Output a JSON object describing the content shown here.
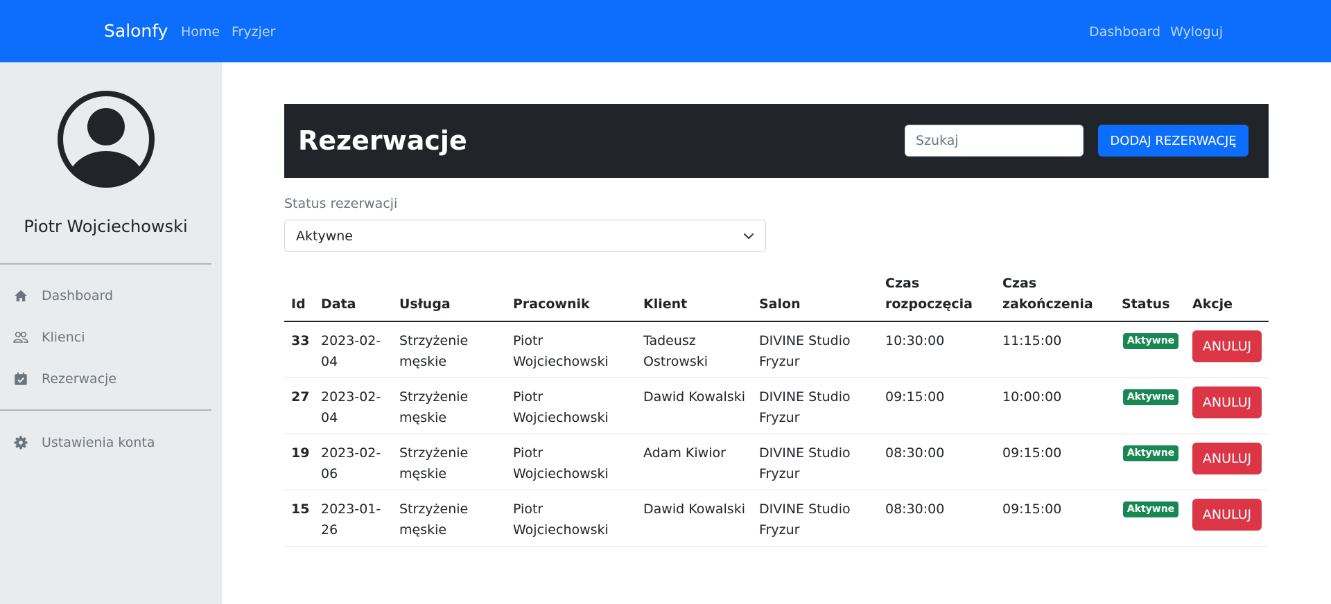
{
  "navbar": {
    "brand": "Salonfy",
    "links": [
      "Home",
      "Fryzjer"
    ],
    "right_links": [
      "Dashboard",
      "Wyloguj"
    ]
  },
  "sidebar": {
    "user_name": "Piotr Wojciechowski",
    "items": [
      {
        "label": "Dashboard",
        "icon": "home-icon"
      },
      {
        "label": "Klienci",
        "icon": "users-icon"
      },
      {
        "label": "Rezerwacje",
        "icon": "calendar-check-icon"
      }
    ],
    "settings": {
      "label": "Ustawienia konta",
      "icon": "gear-icon"
    }
  },
  "header": {
    "title": "Rezerwacje",
    "search_placeholder": "Szukaj",
    "add_button_label": "DODAJ REZERWACJĘ"
  },
  "filter": {
    "label": "Status rezerwacji",
    "selected": "Aktywne"
  },
  "table": {
    "columns": [
      "Id",
      "Data",
      "Usługa",
      "Pracownik",
      "Klient",
      "Salon",
      "Czas\nrozpoczęcia",
      "Czas\nzakończenia",
      "Status",
      "Akcje"
    ],
    "rows": [
      {
        "id": "33",
        "date": "2023-02-\n04",
        "service": "Strzyżenie\nmęskie",
        "employee": "Piotr\nWojciechowski",
        "client": "Tadeusz\nOstrowski",
        "salon": "DIVINE Studio\nFryzur",
        "start": "10:30:00",
        "end": "11:15:00",
        "status": "Aktywne",
        "action": "ANULUJ"
      },
      {
        "id": "27",
        "date": "2023-02-\n04",
        "service": "Strzyżenie\nmęskie",
        "employee": "Piotr\nWojciechowski",
        "client": "Dawid Kowalski",
        "salon": "DIVINE Studio\nFryzur",
        "start": "09:15:00",
        "end": "10:00:00",
        "status": "Aktywne",
        "action": "ANULUJ"
      },
      {
        "id": "19",
        "date": "2023-02-\n06",
        "service": "Strzyżenie\nmęskie",
        "employee": "Piotr\nWojciechowski",
        "client": "Adam Kiwior",
        "salon": "DIVINE Studio\nFryzur",
        "start": "08:30:00",
        "end": "09:15:00",
        "status": "Aktywne",
        "action": "ANULUJ"
      },
      {
        "id": "15",
        "date": "2023-01-\n26",
        "service": "Strzyżenie\nmęskie",
        "employee": "Piotr\nWojciechowski",
        "client": "Dawid Kowalski",
        "salon": "DIVINE Studio\nFryzur",
        "start": "08:30:00",
        "end": "09:15:00",
        "status": "Aktywne",
        "action": "ANULUJ"
      }
    ]
  },
  "colors": {
    "navbar": "#0d6efd",
    "header_panel": "#212529",
    "sidebar": "#e9ecef",
    "badge_active": "#198754",
    "cancel": "#dc3545"
  }
}
